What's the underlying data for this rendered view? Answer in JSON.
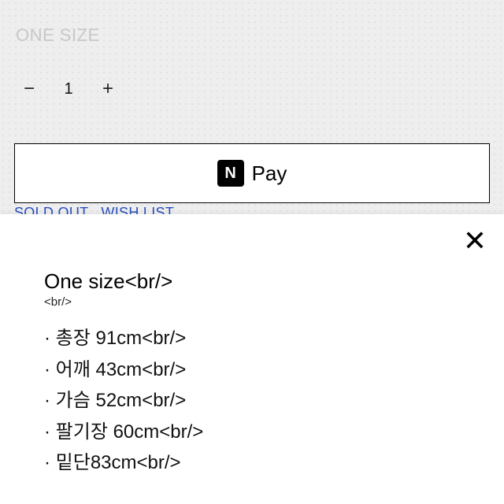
{
  "size_label": "ONE SIZE",
  "quantity": {
    "minus_glyph": "−",
    "plus_glyph": "+",
    "value": "1"
  },
  "pay": {
    "chip_letter": "N",
    "label": "Pay"
  },
  "links": {
    "sold_out": "SOLD OUT",
    "wish_list": "WISH LIST"
  },
  "sheet": {
    "close_glyph": "✕",
    "title": "One size<br/>",
    "br_small": "<br/>",
    "lines": [
      "· 총장 91cm<br/>",
      "· 어깨 43cm<br/>",
      "· 가슴 52cm<br/>",
      "· 팔기장 60cm<br/>",
      "· 밑단83cm<br/>"
    ]
  }
}
